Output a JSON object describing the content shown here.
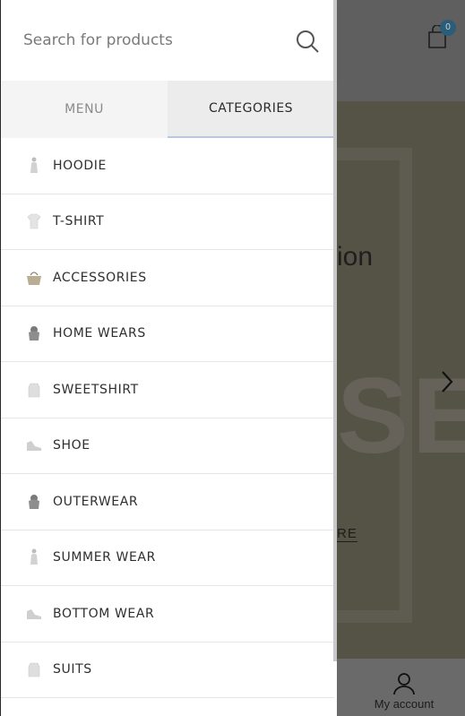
{
  "search": {
    "placeholder": "Search for products"
  },
  "tabs": [
    {
      "label": "MENU",
      "active": false
    },
    {
      "label": "CATEGORIES",
      "active": true
    }
  ],
  "categories": [
    {
      "label": "HOODIE",
      "icon": "figure-thumb"
    },
    {
      "label": "T-SHIRT",
      "icon": "tshirt-thumb"
    },
    {
      "label": "ACCESSORIES",
      "icon": "bag-thumb"
    },
    {
      "label": "HOME WEARS",
      "icon": "hoodie-thumb"
    },
    {
      "label": "SWEETSHIRT",
      "icon": "sweater-thumb"
    },
    {
      "label": "SHOE",
      "icon": "shoe-thumb"
    },
    {
      "label": "OUTERWEAR",
      "icon": "hoodie-thumb"
    },
    {
      "label": "SUMMER WEAR",
      "icon": "figure-thumb"
    },
    {
      "label": "BOTTOM WEAR",
      "icon": "shoe-thumb"
    },
    {
      "label": "SUITS",
      "icon": "sweater-thumb"
    }
  ],
  "background": {
    "cart_count": "0",
    "hero_text": "ion",
    "hero_big": "SE",
    "hero_link": "RE",
    "account_label": "My account"
  },
  "colors": {
    "overlay": "#5c5c5c",
    "active_tab_underline": "#b7c8e0",
    "cart_badge": "#2b5d78"
  }
}
